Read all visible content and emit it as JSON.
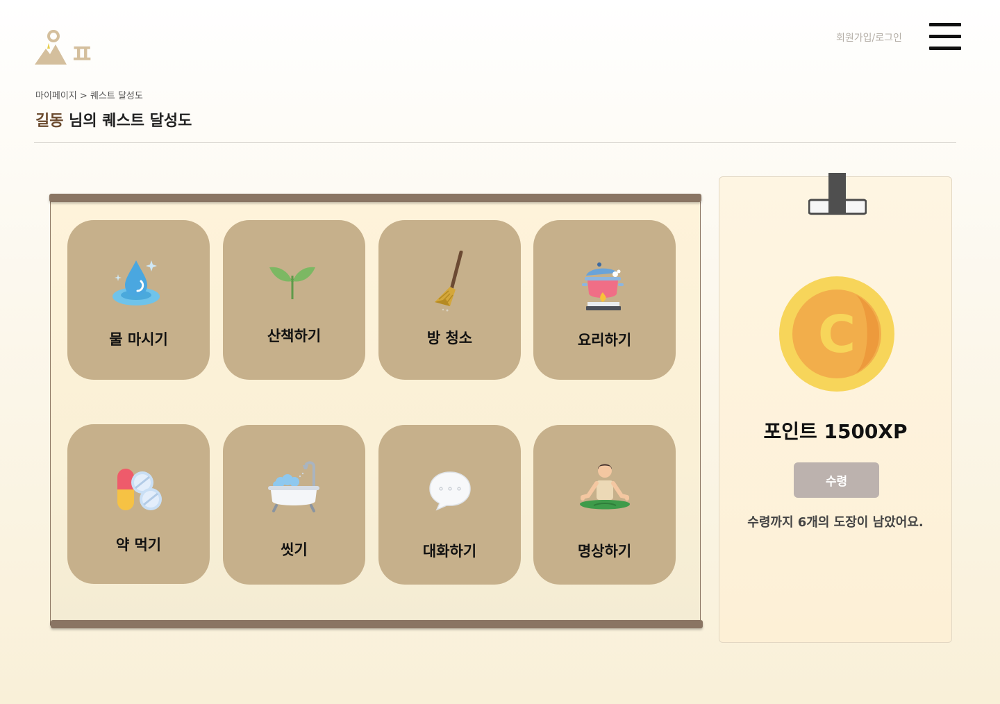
{
  "header": {
    "logo_label": "ㅍ",
    "auth_link": "회원가입/로그인"
  },
  "breadcrumb": "마이페이지 > 퀘스트 달성도",
  "title": {
    "user_name": "길동",
    "suffix": "님의 퀘스트 달성도"
  },
  "quests": [
    {
      "label": "물 마시기",
      "icon": "water-drop-icon"
    },
    {
      "label": "산책하기",
      "icon": "sprout-icon"
    },
    {
      "label": "방 청소",
      "icon": "broom-icon"
    },
    {
      "label": "요리하기",
      "icon": "cooking-pot-icon"
    },
    {
      "label": "약 먹기",
      "icon": "pills-icon"
    },
    {
      "label": "씻기",
      "icon": "bathtub-icon"
    },
    {
      "label": "대화하기",
      "icon": "speech-bubble-icon"
    },
    {
      "label": "명상하기",
      "icon": "meditation-icon"
    }
  ],
  "points": {
    "coin_letter": "C",
    "text": "포인트 1500XP",
    "claim_label": "수령",
    "remaining_text": "수령까지 6개의 도장이 남았어요."
  },
  "colors": {
    "tile": "#c6b08b",
    "rod": "#8a7563",
    "claim_button": "#bcb2ae",
    "coin_outer": "#f7d55a",
    "coin_inner": "#f2ae4b"
  }
}
